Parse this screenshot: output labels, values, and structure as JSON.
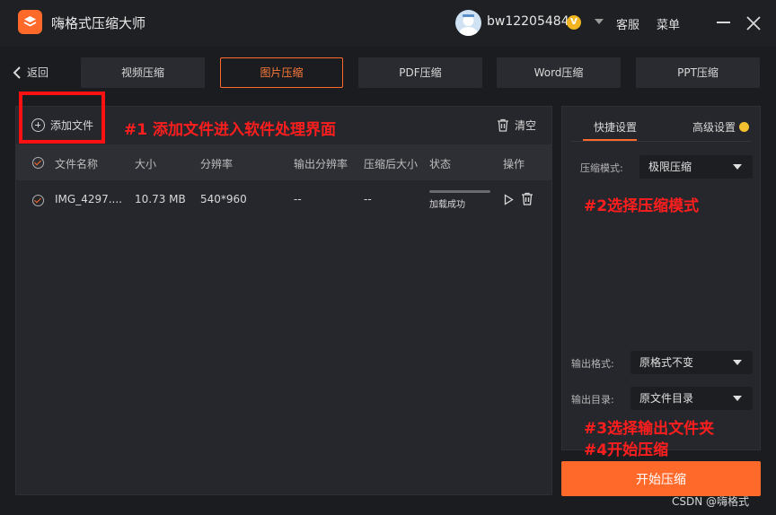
{
  "app": {
    "title": "嗨格式压缩大师",
    "username": "bw12205484",
    "vip_badge": "V",
    "service": "客服",
    "menu": "菜单"
  },
  "nav": {
    "back": "返回",
    "tabs": [
      {
        "label": "视频压缩"
      },
      {
        "label": "图片压缩",
        "active": true
      },
      {
        "label": "PDF压缩"
      },
      {
        "label": "Word压缩"
      },
      {
        "label": "PPT压缩"
      }
    ]
  },
  "file_panel": {
    "add_file": "添加文件",
    "clear": "清空",
    "columns": [
      "文件名称",
      "大小",
      "分辨率",
      "输出分辨率",
      "压缩后大小",
      "状态",
      "操作"
    ],
    "rows": [
      {
        "name": "IMG_4297....",
        "size": "10.73 MB",
        "resolution": "540*960",
        "output_resolution": "--",
        "compressed_size": "--",
        "status": "加载成功",
        "progress": 1.0
      }
    ]
  },
  "settings_panel": {
    "tabs": [
      "快捷设置",
      "高级设置"
    ],
    "mode_label": "压缩模式:",
    "mode_value": "极限压缩",
    "format_label": "输出格式:",
    "format_value": "原格式不变",
    "dir_label": "输出目录:",
    "dir_value": "原文件目录"
  },
  "start_button": "开始压缩",
  "annotations": {
    "step1": "#1 添加文件进入软件处理界面",
    "step2": "#2选择压缩模式",
    "step3": "#3选择输出文件夹",
    "step4": "#4开始压缩"
  },
  "watermark": "CSDN @嗨格式",
  "colors": {
    "accent": "#ff6a2b",
    "annotation": "#ff1e1e",
    "background": "#1b1c20",
    "panel": "#26272c"
  }
}
